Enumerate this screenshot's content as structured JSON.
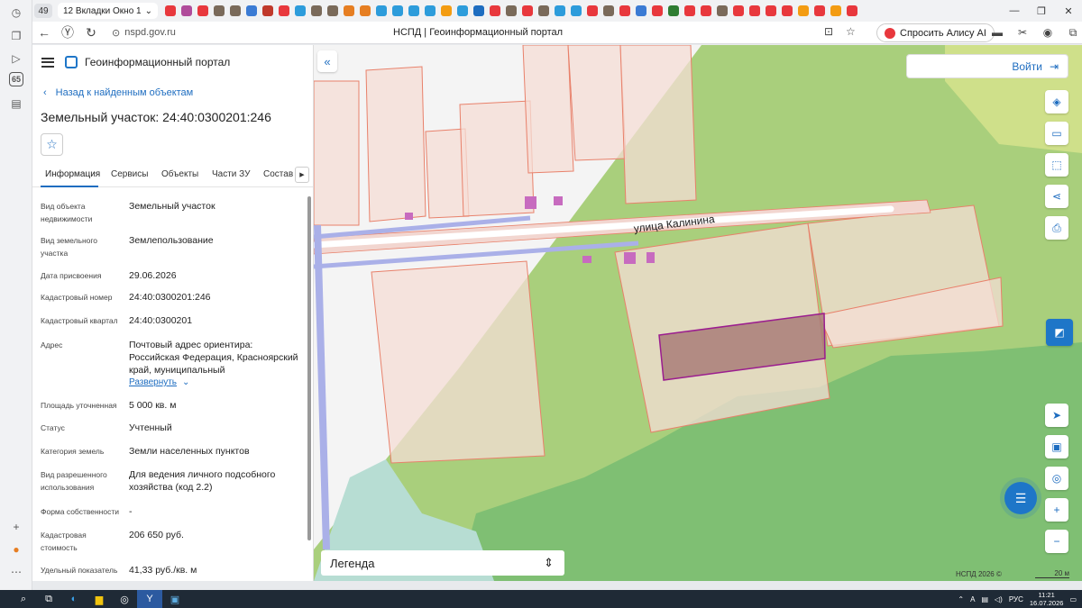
{
  "browser": {
    "tab_count": "49",
    "tab_group_label": "12 Вкладки Окно 1",
    "url": "nspd.gov.ru",
    "page_title": "НСПД | Геоинформационный портал",
    "alice_label": "Спросить Алису AI",
    "tab_icon_colors": [
      "#e8383d",
      "#b04c9b",
      "#e8383d",
      "#7a6a5a",
      "#7a6a5a",
      "#3b7bd4",
      "#c0392b",
      "#e8383d",
      "#2d9cdb",
      "#7a6a5a",
      "#7a6a5a",
      "#e67e22",
      "#e67e22",
      "#2d9cdb",
      "#2d9cdb",
      "#2d9cdb",
      "#2d9cdb",
      "#f39c12",
      "#2d9cdb",
      "#1e6dc0",
      "#e8383d",
      "#7a6a5a",
      "#e8383d",
      "#7a6a5a",
      "#2d9cdb",
      "#2d9cdb",
      "#e8383d",
      "#7a6a5a",
      "#e8383d",
      "#3b7bd4",
      "#e8383d",
      "#2e7d32",
      "#e8383d",
      "#e8383d",
      "#7a6a5a",
      "#e8383d",
      "#e8383d",
      "#e8383d",
      "#e8383d",
      "#f39c12",
      "#e8383d",
      "#f39c12",
      "#e8383d"
    ]
  },
  "app": {
    "title": "Геоинформационный портал",
    "back_link": "Назад к найденным объектам",
    "object_title": "Земельный участок: 24:40:0300201:246",
    "tabs": [
      "Информация",
      "Сервисы",
      "Объекты",
      "Части ЗУ",
      "Состав"
    ],
    "fields": [
      {
        "label": "Вид объекта недвижимости",
        "value": "Земельный участок"
      },
      {
        "label": "Вид земельного участка",
        "value": "Землепользование"
      },
      {
        "label": "Дата присвоения",
        "value": "29.06.2026"
      },
      {
        "label": "Кадастровый номер",
        "value": "24:40:0300201:246"
      },
      {
        "label": "Кадастровый квартал",
        "value": "24:40:0300201"
      },
      {
        "label": "Адрес",
        "value": "Почтовый адрес ориентира: Российская Федерация, Красноярский край, муниципальный"
      },
      {
        "label": "Площадь уточненная",
        "value": "5 000 кв. м"
      },
      {
        "label": "Статус",
        "value": "Учтенный"
      },
      {
        "label": "Категория земель",
        "value": "Земли населенных пунктов"
      },
      {
        "label": "Вид разрешенного использования",
        "value": "Для ведения личного подсобного хозяйства (код 2.2)"
      },
      {
        "label": "Форма собственности",
        "value": "-"
      },
      {
        "label": "Кадастровая стоимость",
        "value": "206 650 руб."
      },
      {
        "label": "Удельный показатель",
        "value": "41,33 руб./кв. м"
      }
    ],
    "expand_link": "Развернуть"
  },
  "map": {
    "street_label": "улица Калинина",
    "login_label": "Войти",
    "legend_label": "Легенда",
    "copyright": "НСПД 2026 ©",
    "scale": "20 м",
    "colors": {
      "green_light": "#a9cf7c",
      "green_dark": "#7fbf73",
      "parcel_fill": "#f5ddd6",
      "parcel_stroke": "#e8806a",
      "selected": "#9b1d8f",
      "road": "#aab0e8"
    }
  },
  "taskbar": {
    "lang": "РУС",
    "time": "11:21",
    "date": "16.07.2026"
  }
}
